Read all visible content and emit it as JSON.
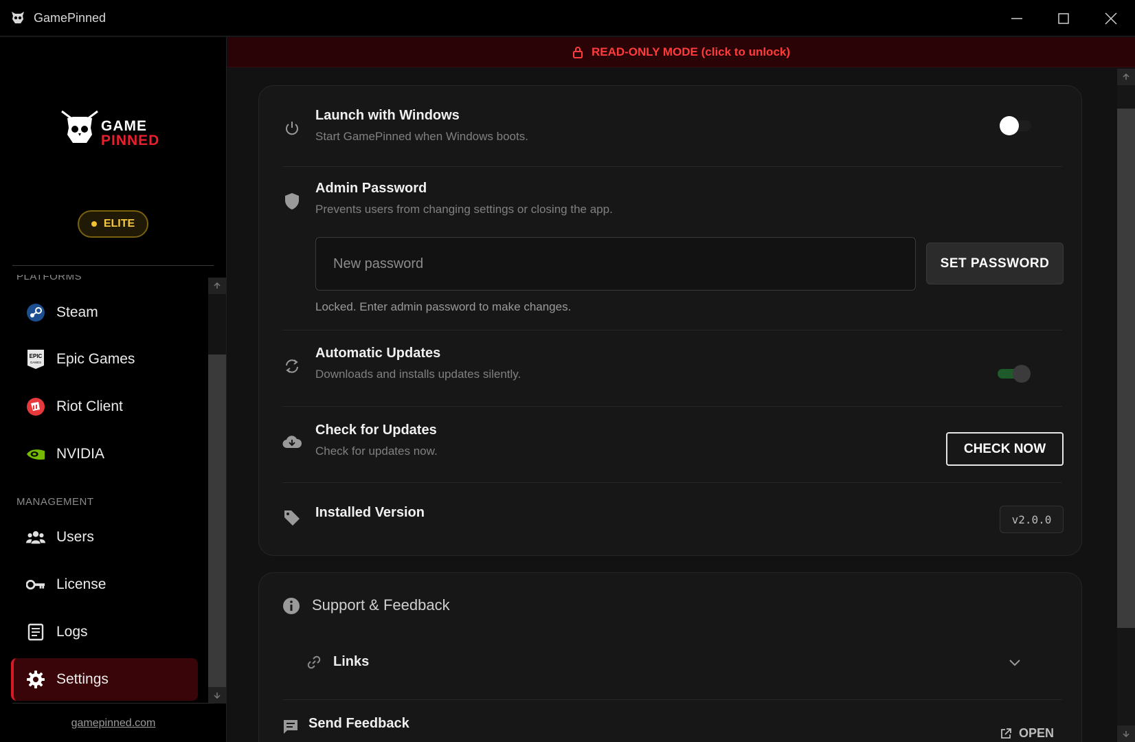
{
  "window": {
    "title": "GamePinned",
    "controls": [
      "minimize-icon",
      "maximize-icon",
      "close-icon"
    ]
  },
  "sidebar": {
    "logo": {
      "line1": "GAME",
      "line2": "PINNED"
    },
    "tier_badge": "ELITE",
    "sections": [
      {
        "label": "PLATFORMS",
        "items": [
          {
            "label": "Steam",
            "icon": "steam-icon"
          },
          {
            "label": "Epic Games",
            "icon": "epic-games-icon"
          },
          {
            "label": "Riot Client",
            "icon": "riot-client-icon"
          },
          {
            "label": "NVIDIA",
            "icon": "nvidia-icon"
          }
        ]
      },
      {
        "label": "MANAGEMENT",
        "items": [
          {
            "label": "Users",
            "icon": "users-icon"
          },
          {
            "label": "License",
            "icon": "key-icon"
          },
          {
            "label": "Logs",
            "icon": "logs-icon"
          },
          {
            "label": "Settings",
            "icon": "gear-icon",
            "active": true
          }
        ]
      }
    ],
    "footer_link": "gamepinned.com"
  },
  "banner": {
    "text": "READ-ONLY MODE (click to unlock)",
    "color": "#ff3b3b"
  },
  "settings": {
    "launch_with_windows": {
      "title": "Launch with Windows",
      "description": "Start GamePinned when Windows boots.",
      "enabled": false
    },
    "admin_password": {
      "title": "Admin Password",
      "description": "Prevents users from changing settings or closing the app.",
      "input_placeholder": "New password",
      "input_value": "",
      "button_label": "SET PASSWORD",
      "note": "Locked. Enter admin password to make changes."
    },
    "automatic_updates": {
      "title": "Automatic Updates",
      "description": "Downloads and installs updates silently.",
      "enabled": true
    },
    "check_for_updates": {
      "title": "Check for Updates",
      "description": "Check for updates now.",
      "button_label": "CHECK NOW"
    },
    "installed_version": {
      "title": "Installed Version",
      "value": "v2.0.0"
    }
  },
  "support": {
    "title": "Support & Feedback",
    "links_label": "Links",
    "send_feedback": {
      "title": "Send Feedback",
      "action_label": "OPEN"
    }
  },
  "colors": {
    "accent_red": "#d71a24",
    "elite_gold": "#f5c940",
    "toggle_on": "#1f5a2a"
  }
}
